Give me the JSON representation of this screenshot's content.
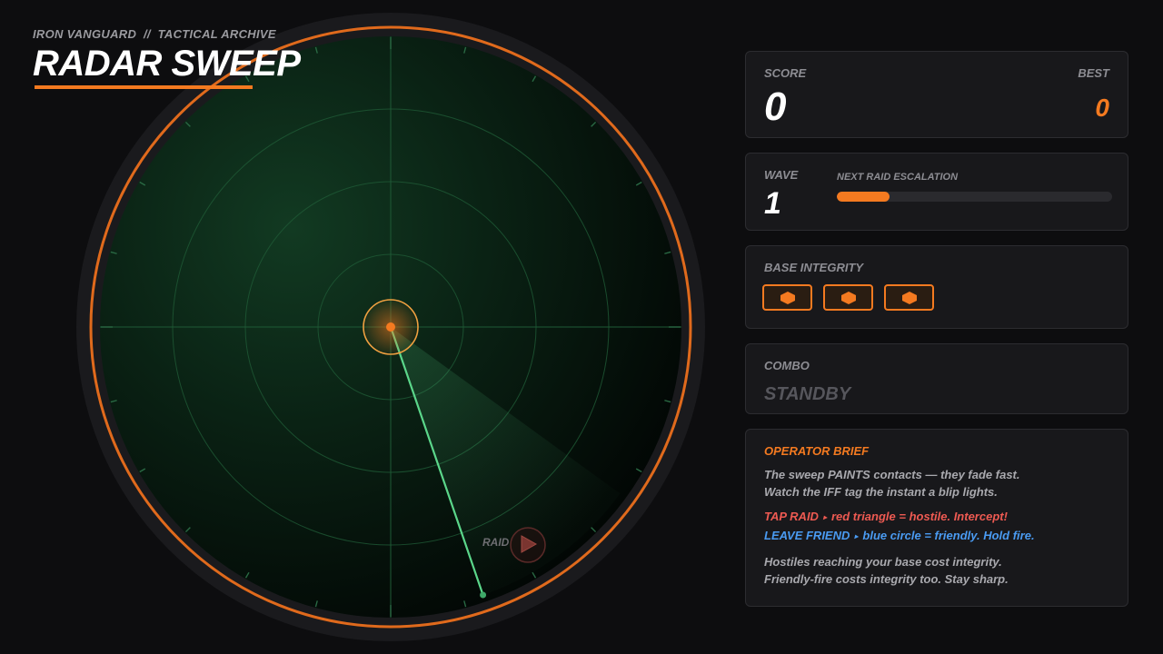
{
  "header": {
    "subtitle": "IRON VANGUARD  //  TACTICAL ARCHIVE",
    "title": "RADAR SWEEP"
  },
  "score": {
    "label": "SCORE",
    "value": "0",
    "best_label": "BEST",
    "best_value": "0"
  },
  "wave": {
    "label": "WAVE",
    "value": "1",
    "escalation_label": "NEXT RAID ESCALATION",
    "escalation_progress": 0.19
  },
  "base": {
    "label": "BASE INTEGRITY",
    "pips": 3
  },
  "combo": {
    "label": "COMBO",
    "value": "STANDBY"
  },
  "brief": {
    "title": "OPERATOR BRIEF",
    "line1": "The sweep PAINTS contacts — they fade fast.",
    "line2": "Watch the IFF tag the instant a blip lights.",
    "raid_action": "TAP RAID",
    "raid_text": "red triangle = hostile. Intercept!",
    "friend_action": "LEAVE FRIEND",
    "friend_text": "blue circle = friendly. Hold fire.",
    "line5": "Hostiles reaching your base cost integrity.",
    "line6": "Friendly-fire costs integrity too. Stay sharp."
  },
  "radar": {
    "contact_label": "RAID",
    "contact_icon": "red-triangle-icon",
    "sweep_angle_deg": 161,
    "colors": {
      "accent": "#f47a20",
      "sweep": "#5bd68a",
      "hostile": "#ee5a52",
      "friendly": "#4a9bf2"
    }
  }
}
